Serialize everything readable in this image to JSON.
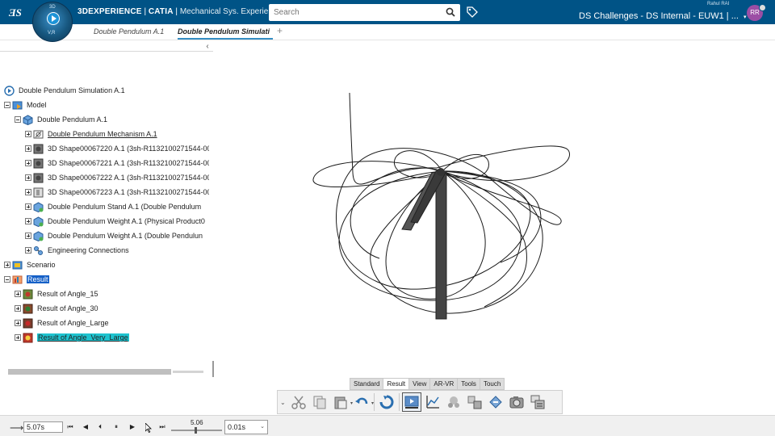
{
  "app": {
    "brand": "3DEXPERIENCE",
    "product": "CATIA",
    "app_name": "Mechanical Sys. Experie...",
    "compass_top": "3D",
    "compass_bottom": "V,R",
    "search_placeholder": "Search",
    "user_name": "Rahul RAI",
    "platform": "DS Challenges - DS Internal - EUW1 | ...",
    "avatar_initials": "RR",
    "brand_color": "#005386"
  },
  "tabs": [
    {
      "label": "Double Pendulum A.1"
    },
    {
      "label": "Double Pendulum Simulati"
    }
  ],
  "tree": {
    "root": "Double Pendulum Simulation A.1",
    "model": "Model",
    "pendulum": "Double Pendulum A.1",
    "items": [
      "Double Pendulum Mechanism A.1",
      "3D Shape00067220 A.1 (3sh-R1132100271544-00",
      "3D Shape00067221 A.1 (3sh-R1132100271544-00",
      "3D Shape00067222 A.1 (3sh-R1132100271544-00",
      "3D Shape00067223 A.1 (3sh-R1132100271544-00",
      "Double Pendulum Stand A.1 (Double Pendulum",
      "Double Pendulum Weight A.1 (Physical Product0",
      "Double Pendulum Weight A.1 (Double Pendulun",
      "Engineering Connections"
    ],
    "scenario": "Scenario",
    "result": "Result",
    "results": [
      "Result of Angle_15",
      "Result of Angle_30",
      "Result of Angle_Large",
      "Result of Angle_Very_Large"
    ]
  },
  "action_bar": {
    "tabs": [
      "Standard",
      "Result",
      "View",
      "AR-VR",
      "Tools",
      "Touch"
    ],
    "active_tab": "Result",
    "icons": [
      "cut-icon",
      "copy-icon",
      "paste-icon",
      "undo-icon",
      "update-icon",
      "player-icon",
      "plot-icon",
      "sensor-icon",
      "trace-icon",
      "fast-icon",
      "capture-icon",
      "results-manager-icon"
    ]
  },
  "player": {
    "current_time": "5.07s",
    "slider_value": "5.06",
    "step": "0.01s"
  }
}
